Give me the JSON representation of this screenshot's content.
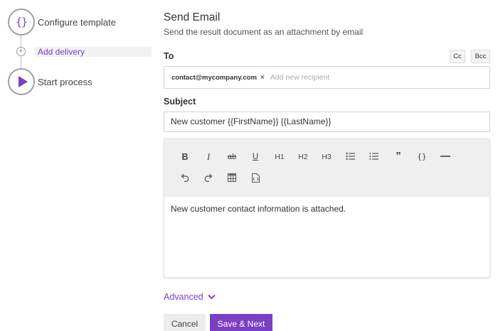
{
  "stepper": {
    "steps": [
      {
        "label": "Configure template",
        "icon": "braces-icon",
        "glyph": "{}"
      },
      {
        "label": "Add delivery",
        "icon": "plus-icon",
        "glyph": "+"
      },
      {
        "label": "Start process",
        "icon": "play-icon"
      }
    ]
  },
  "email": {
    "title": "Send Email",
    "subtitle": "Send the result document as an attachment by email",
    "to_label": "To",
    "cc_label": "Cc",
    "bcc_label": "Bcc",
    "recipients": [
      "contact@mycompany.com"
    ],
    "remove_glyph": "×",
    "recipient_placeholder": "Add new recipient",
    "subject_label": "Subject",
    "subject_value": "New customer {{FirstName}} {{LastName}}",
    "body_text": "New customer contact information is attached."
  },
  "toolbar": {
    "buttons": [
      {
        "name": "bold-button",
        "icon": "bold-icon",
        "text": "B"
      },
      {
        "name": "italic-button",
        "icon": "italic-icon",
        "text": "I"
      },
      {
        "name": "strikethrough-button",
        "icon": "strikethrough-icon",
        "text": "ab"
      },
      {
        "name": "underline-button",
        "icon": "underline-icon",
        "text": "U"
      },
      {
        "name": "heading1-button",
        "icon": "heading1-icon",
        "text": "H1"
      },
      {
        "name": "heading2-button",
        "icon": "heading2-icon",
        "text": "H2"
      },
      {
        "name": "heading3-button",
        "icon": "heading3-icon",
        "text": "H3"
      },
      {
        "name": "bullet-list-button",
        "icon": "bullet-list-icon"
      },
      {
        "name": "ordered-list-button",
        "icon": "ordered-list-icon"
      },
      {
        "name": "blockquote-button",
        "icon": "quote-icon",
        "text": "”"
      },
      {
        "name": "code-button",
        "icon": "code-braces-icon",
        "text": "{}"
      },
      {
        "name": "horizontal-rule-button",
        "icon": "horizontal-rule-icon"
      },
      {
        "name": "undo-button",
        "icon": "undo-icon"
      },
      {
        "name": "redo-button",
        "icon": "redo-icon"
      },
      {
        "name": "table-button",
        "icon": "table-icon"
      },
      {
        "name": "insert-field-button",
        "icon": "insert-field-icon"
      }
    ]
  },
  "footer": {
    "advanced_label": "Advanced",
    "cancel_label": "Cancel",
    "save_label": "Save & Next"
  },
  "colors": {
    "accent": "#7b3fc4",
    "toolbar_bg": "#efefef",
    "cancel_bg": "#ececec"
  }
}
